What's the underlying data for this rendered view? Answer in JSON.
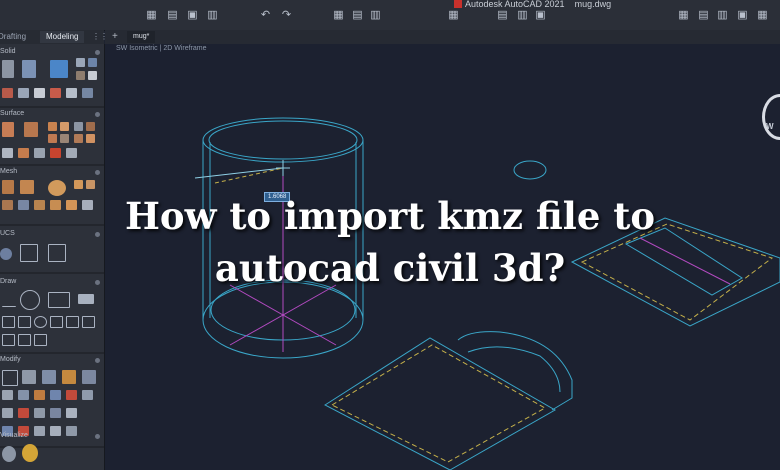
{
  "app": {
    "title": "Autodesk AutoCAD 2021",
    "filename": "mug.dwg",
    "brand_color": "#c8312c"
  },
  "workspace_tabs": [
    "Drafting",
    "Modeling"
  ],
  "palette": {
    "sections": [
      "Solid",
      "Surface",
      "Mesh",
      "UCS",
      "Draw",
      "Modify",
      "Visualize"
    ]
  },
  "document": {
    "tab": "mug*",
    "view_label": "SW Isometric | 2D Wireframe",
    "dimension_value": "1.6068"
  },
  "viewcube": {
    "letter": "W"
  },
  "overlay": {
    "title": "How to import kmz file to autocad civil 3d?"
  },
  "colors": {
    "cyan_lines": "#3aa6c8",
    "magenta_center": "#b24ac0",
    "hatch_yellow": "#c4b04a",
    "background": "#1c2130"
  },
  "icons": [
    "save-icon",
    "open-icon",
    "undo-icon",
    "redo-icon",
    "print-icon",
    "new-tab-icon"
  ]
}
